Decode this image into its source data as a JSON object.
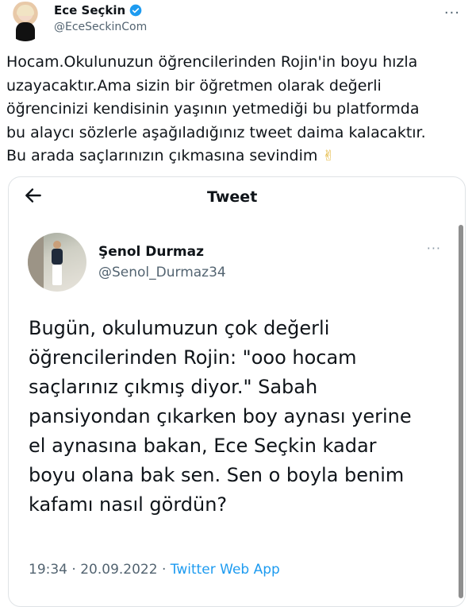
{
  "outer_tweet": {
    "author_name": "Ece Seçkin",
    "author_handle": "@EceSeckinCom",
    "more": "···",
    "text": "Hocam.Okulunuzun  öğrencilerinden Rojin'in boyu hızla\nuzayacaktır.Ama sizin bir öğretmen olarak değerli\nöğrencinizi kendisinin yaşının yetmediği bu platformda\nbu alaycı sözlerle aşağıladığınız tweet daima kalacaktır.\nBu arada saçlarınızın çıkmasına sevindim",
    "emoji": "✌",
    "verified_color": "#1d9bf0"
  },
  "card": {
    "back_icon": "arrow-left-icon",
    "title": "Tweet",
    "author_name": "Şenol Durmaz",
    "author_handle": "@Senol_Durmaz34",
    "more": "···",
    "text": "Bugün, okulumuzun çok değerli\nöğrencilerinden Rojin: \"ooo hocam\nsaçlarınız çıkmış diyor.\" Sabah\npansiyondan çıkarken boy aynası yerine\nel aynasına bakan, Ece Seçkin kadar\nboyu olana bak sen. Sen o boyla benim\nkafamı nasıl gördün?",
    "time": "19:34",
    "date": "20.09.2022",
    "separator": "·",
    "source": "Twitter Web App",
    "link_color": "#1d9bf0"
  }
}
